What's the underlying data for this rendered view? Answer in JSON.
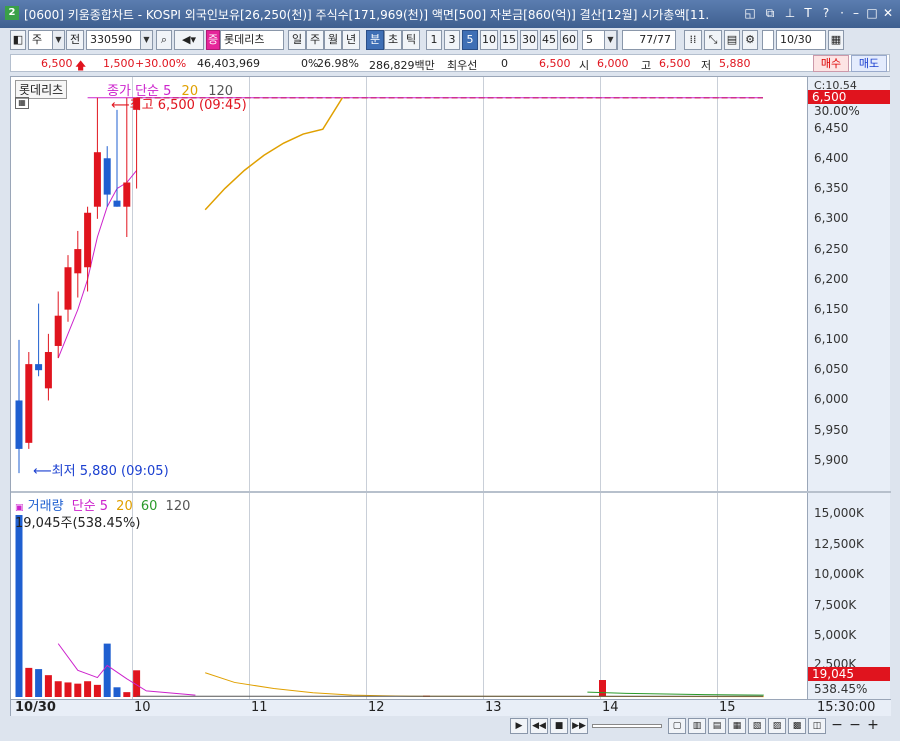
{
  "window": {
    "title": "[0600] 키움종합차트 - KOSPI 외국인보유[26,250(천)] 주식수[171,969(천)] 액면[500] 자본금[860(억)] 결산[12월] 시가총액[11."
  },
  "toolbar": {
    "period_main": "주",
    "prev_label": "전",
    "code": "330590",
    "stock_badge": "증",
    "stock_name": "롯데리츠",
    "timeframes": [
      "일",
      "주",
      "월",
      "년",
      "분",
      "초",
      "틱"
    ],
    "minutes": [
      "1",
      "3",
      "5",
      "10",
      "15",
      "30",
      "45",
      "60"
    ],
    "active_minute": "5",
    "interval_value": "5",
    "count": "77/77",
    "date": "10/30"
  },
  "quote": {
    "price": "6,500",
    "change": "1,500",
    "change_pct": "+30.00%",
    "volume": "46,403,969",
    "pct_label": "0%",
    "pct_value": "26.98%",
    "amount": "286,829백만",
    "priority_label": "최우선",
    "priority_value": "0",
    "last": "6,500",
    "open_label": "시",
    "open": "6,000",
    "high_label": "고",
    "high": "6,500",
    "low_label": "저",
    "low": "5,880",
    "buy_label": "매수",
    "sell_label": "매도"
  },
  "price_panel": {
    "name_tag": "롯데리츠",
    "legend": {
      "close": "종가",
      "type": "단순",
      "ma": [
        "5",
        "20",
        "120"
      ]
    },
    "high_annotation": "최고 6,500 (09:45)",
    "low_annotation": "최저 5,880 (09:05)",
    "ceiling_label": "C:10.54",
    "last_price_box": "6,500",
    "pct_box": "30.00%",
    "y_ticks": [
      "6,450",
      "6,400",
      "6,350",
      "6,300",
      "6,250",
      "6,200",
      "6,150",
      "6,100",
      "6,050",
      "6,000",
      "5,950",
      "5,900"
    ]
  },
  "volume_panel": {
    "legend": {
      "name": "거래량",
      "type": "단순",
      "ma": [
        "5",
        "20",
        "60",
        "120"
      ]
    },
    "info": "19,045주(538.45%)",
    "last_box": "19,045",
    "pct_box": "538.45%",
    "y_ticks": [
      "15,000K",
      "12,500K",
      "10,000K",
      "7,500K",
      "5,000K",
      "2,500K"
    ]
  },
  "x_axis": {
    "ticks": [
      "10/30",
      "10",
      "11",
      "12",
      "13",
      "14",
      "15"
    ],
    "time": "15:30:00"
  },
  "colors": {
    "up": "#e0141e",
    "down": "#1f5fd0",
    "ma5": "#cc22cc",
    "ma20": "#e0a000",
    "ma60": "#2a9a2a",
    "ma120": "#555555"
  },
  "chart_data": [
    {
      "type": "candlestick",
      "interval": "5분",
      "note": "price panel; x values are bar times",
      "x": [
        "09:00",
        "09:05",
        "09:10",
        "09:15",
        "09:20",
        "09:25",
        "09:30",
        "09:35",
        "09:40",
        "09:45",
        "09:50",
        "09:55",
        "10:00"
      ],
      "open": [
        6000,
        5930,
        6060,
        6020,
        6090,
        6150,
        6210,
        6220,
        6320,
        6400,
        6330,
        6320,
        6480
      ],
      "high": [
        6100,
        6080,
        6160,
        6110,
        6180,
        6240,
        6280,
        6320,
        6500,
        6420,
        6480,
        6500,
        6500
      ],
      "low": [
        5880,
        5920,
        6040,
        6000,
        6070,
        6130,
        6170,
        6180,
        6300,
        6320,
        6320,
        6270,
        6350
      ],
      "close": [
        5920,
        6060,
        6050,
        6080,
        6140,
        6220,
        6250,
        6310,
        6410,
        6340,
        6320,
        6360,
        6500
      ],
      "ma5": [
        null,
        null,
        null,
        null,
        6070,
        6110,
        6150,
        6200,
        6270,
        6320,
        6350,
        6360,
        6380
      ],
      "ylim": [
        5860,
        6540
      ]
    },
    {
      "type": "bar",
      "note": "volume panel (K shares)",
      "x": [
        "09:00",
        "09:05",
        "09:10",
        "09:15",
        "09:20",
        "09:25",
        "09:30",
        "09:35",
        "09:40",
        "09:45",
        "09:50",
        "09:55",
        "10:00"
      ],
      "values": [
        15000,
        2400,
        2300,
        1800,
        1300,
        1200,
        1100,
        1300,
        1000,
        4400,
        800,
        400,
        2200
      ],
      "ylim": [
        0,
        16000
      ]
    }
  ]
}
